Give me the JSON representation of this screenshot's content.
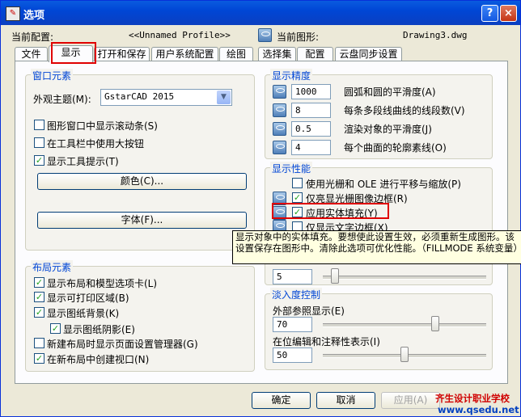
{
  "window": {
    "title": "选项",
    "help_label": "?",
    "close_label": "×"
  },
  "config": {
    "current_config_label": "当前配置:",
    "current_config_value": "<<Unnamed Profile>>",
    "current_drawing_label": "当前图形:",
    "current_drawing_value": "Drawing3.dwg"
  },
  "tabs": [
    "文件",
    "显示",
    "打开和保存",
    "用户系统配置",
    "绘图",
    "选择集",
    "配置",
    "云盘同步设置"
  ],
  "window_elements": {
    "title": "窗口元素",
    "theme_label": "外观主题(M):",
    "theme_value": "GstarCAD 2015",
    "checks": [
      {
        "label": "图形窗口中显示滚动条(S)",
        "checked": false
      },
      {
        "label": "在工具栏中使用大按钮",
        "checked": false
      },
      {
        "label": "显示工具提示(T)",
        "checked": true
      }
    ],
    "color_button": "颜色(C)...",
    "font_button": "字体(F)..."
  },
  "layout_elements": {
    "title": "布局元素",
    "checks": [
      {
        "label": "显示布局和模型选项卡(L)",
        "checked": true
      },
      {
        "label": "显示可打印区域(B)",
        "checked": true
      },
      {
        "label": "显示图纸背景(K)",
        "checked": true
      },
      {
        "label": "显示图纸阴影(E)",
        "checked": true
      },
      {
        "label": "新建布局时显示页面设置管理器(G)",
        "checked": false
      },
      {
        "label": "在新布局中创建视口(N)",
        "checked": true
      }
    ]
  },
  "display_resolution": {
    "title": "显示精度",
    "rows": [
      {
        "value": "1000",
        "label": "圆弧和圆的平滑度(A)"
      },
      {
        "value": "8",
        "label": "每条多段线曲线的线段数(V)"
      },
      {
        "value": "0.5",
        "label": "渲染对象的平滑度(J)"
      },
      {
        "value": "4",
        "label": "每个曲面的轮廓素线(O)"
      }
    ]
  },
  "display_performance": {
    "title": "显示性能",
    "checks": [
      {
        "label": "使用光栅和 OLE 进行平移与缩放(P)",
        "checked": false
      },
      {
        "label": "仅亮显光栅图像边框(R)",
        "checked": true
      },
      {
        "label": "应用实体填充(Y)",
        "checked": true
      },
      {
        "label": "仅显示文字边框(X)",
        "checked": false
      }
    ]
  },
  "crosshair": {
    "value": "5",
    "slider_fraction": 0.05
  },
  "fade_control": {
    "title": "淡入度控制",
    "xref_label": "外部参照显示(E)",
    "xref_value": "70",
    "xref_fraction": 0.7,
    "inplace_label": "在位编辑和注释性表示(I)",
    "inplace_value": "50",
    "inplace_fraction": 0.5
  },
  "tooltip": "显示对象中的实体填充。要想使此设置生效，必须重新生成图形。该设置保存在图形中。清除此选项可优化性能。（FILLMODE 系统变量）",
  "buttons": {
    "ok": "确定",
    "cancel": "取消",
    "apply": "应用(A)"
  },
  "watermark": {
    "line1": "齐生设计职业学校",
    "line2": "www.qsedu.net"
  },
  "colors": {
    "title_bar": "#0046d5",
    "group_title": "#0046d5",
    "highlight_box": "#e00000",
    "tooltip_bg": "#ffffe1"
  }
}
